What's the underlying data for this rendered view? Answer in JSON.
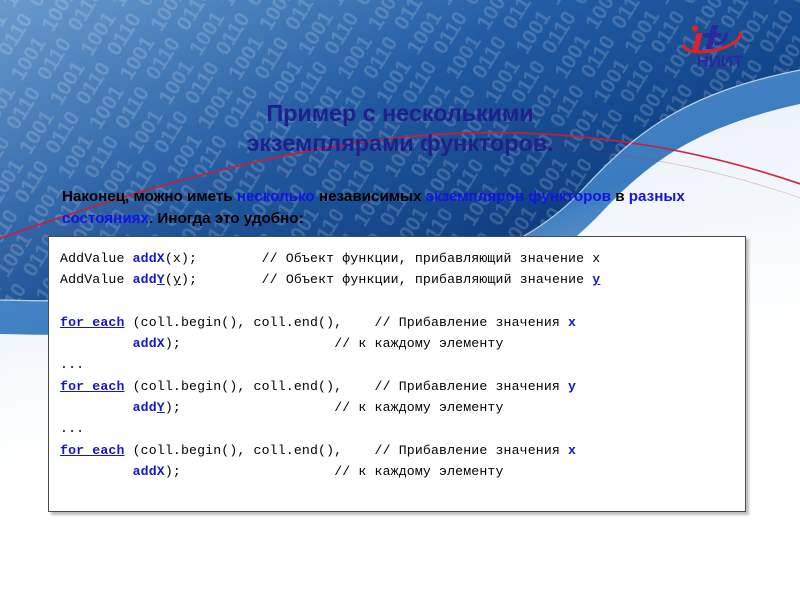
{
  "slide": {
    "title": "Пример с несколькими\nэкземплярами функторов.",
    "title_line1": "Пример с несколькими",
    "title_line2": "экземплярами функторов.",
    "title_color": "#20208c"
  },
  "logo": {
    "name": "it-niit-logo",
    "mark_i": "i",
    "mark_t": "t",
    "wordmark": "НИИТ",
    "color_red": "#e0202a",
    "color_blue": "#2a2a9e"
  },
  "subtitle": {
    "segments": [
      {
        "text": "Наконец, можно иметь ",
        "highlight": false
      },
      {
        "text": "несколько",
        "highlight": true
      },
      {
        "text": " независимых ",
        "highlight": false
      },
      {
        "text": "экземпляров функторов",
        "highlight": true
      },
      {
        "text": " в ",
        "highlight": false
      },
      {
        "text": "разных состояниях",
        "highlight": true
      },
      {
        "text": ". Иногда  это  удобно:",
        "highlight": false
      }
    ],
    "plain_text": "Наконец, можно иметь несколько независимых экземпляров функторов в разных состояниях. Иногда это удобно:",
    "highlight_color": "#1414e0"
  },
  "code_box": {
    "keyword_color": "#1515d0",
    "identifier_color": "#1515d0",
    "text_color": "#000000",
    "border_color": "#4a4a4a",
    "background": "#ffffff",
    "lines": [
      {
        "id": "line-1",
        "tokens": [
          {
            "t": "AddValue ",
            "k": "pl"
          },
          {
            "t": "addX",
            "k": "id"
          },
          {
            "t": "(x);        ",
            "k": "pl"
          },
          {
            "t": "// Объект функции, прибавляющий значение x",
            "k": "cm"
          }
        ]
      },
      {
        "id": "line-2",
        "tokens": [
          {
            "t": "AddValue ",
            "k": "pl"
          },
          {
            "t": "add",
            "k": "id"
          },
          {
            "t": "Y",
            "k": "idu"
          },
          {
            "t": "(",
            "k": "pl"
          },
          {
            "t": "y",
            "k": "plu"
          },
          {
            "t": ");        ",
            "k": "pl"
          },
          {
            "t": "// Объект функции, прибавляющий значение ",
            "k": "cm"
          },
          {
            "t": "y",
            "k": "cmu"
          }
        ]
      },
      {
        "id": "line-3",
        "tokens": [
          {
            "t": "",
            "k": "pl"
          }
        ]
      },
      {
        "id": "line-4",
        "tokens": [
          {
            "t": "for_each",
            "k": "kw"
          },
          {
            "t": " (coll.begin(), coll.end(),    ",
            "k": "pl"
          },
          {
            "t": "// Прибавление значения ",
            "k": "cm"
          },
          {
            "t": "x",
            "k": "cmv"
          }
        ]
      },
      {
        "id": "line-5",
        "tokens": [
          {
            "t": "         ",
            "k": "pl"
          },
          {
            "t": "addX",
            "k": "id"
          },
          {
            "t": ");                   ",
            "k": "pl"
          },
          {
            "t": "// к каждому элементу",
            "k": "cm"
          }
        ]
      },
      {
        "id": "line-6",
        "tokens": [
          {
            "t": "...",
            "k": "pl"
          }
        ]
      },
      {
        "id": "line-7",
        "tokens": [
          {
            "t": "for_each",
            "k": "kw"
          },
          {
            "t": " (coll.begin(), coll.end(),    ",
            "k": "pl"
          },
          {
            "t": "// Прибавление значения ",
            "k": "cm"
          },
          {
            "t": "y",
            "k": "cmv"
          }
        ]
      },
      {
        "id": "line-8",
        "tokens": [
          {
            "t": "         ",
            "k": "pl"
          },
          {
            "t": "add",
            "k": "id"
          },
          {
            "t": "Y",
            "k": "idu"
          },
          {
            "t": ");                   ",
            "k": "pl"
          },
          {
            "t": "// к каждому элементу",
            "k": "cm"
          }
        ]
      },
      {
        "id": "line-9",
        "tokens": [
          {
            "t": "...",
            "k": "pl"
          }
        ]
      },
      {
        "id": "line-10",
        "tokens": [
          {
            "t": "for_each",
            "k": "kw"
          },
          {
            "t": " (coll.begin(), coll.end(),    ",
            "k": "pl"
          },
          {
            "t": "// Прибавление значения ",
            "k": "cm"
          },
          {
            "t": "x",
            "k": "cmv"
          }
        ]
      },
      {
        "id": "line-11",
        "tokens": [
          {
            "t": "         ",
            "k": "pl"
          },
          {
            "t": "addX",
            "k": "id"
          },
          {
            "t": ");                   ",
            "k": "pl"
          },
          {
            "t": "// к каждому элементу",
            "k": "cm"
          }
        ]
      }
    ]
  },
  "background": {
    "binary_digits": "0110100101101000101101001011010010110100",
    "blue_dark": "#0b3f86",
    "blue_mid": "#1b5fb0",
    "blue_light": "#bed6ee",
    "accent_red": "#cc1b3a"
  }
}
